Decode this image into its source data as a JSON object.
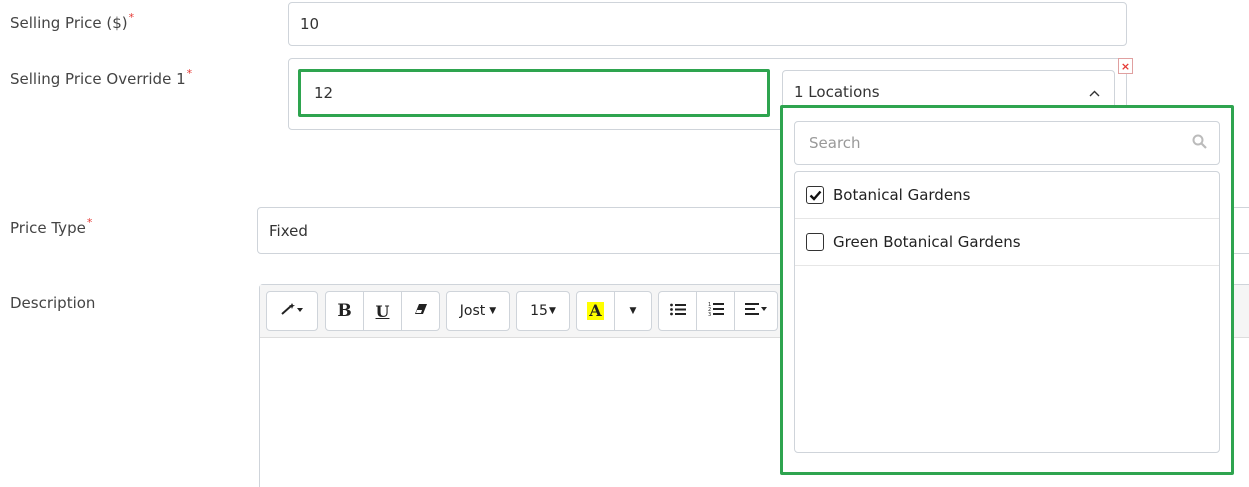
{
  "form": {
    "selling_price": {
      "label": "Selling Price ($)",
      "required": "*",
      "value": "10"
    },
    "override": {
      "label": "Selling Price Override 1",
      "required": "*",
      "value": "12",
      "locations_label": "1 Locations",
      "remove_symbol": "×"
    },
    "price_type": {
      "label": "Price Type",
      "required": "*",
      "value": "Fixed"
    },
    "description": {
      "label": "Description"
    }
  },
  "toolbar": {
    "font_name": "Jost",
    "font_size": "15",
    "icons": [
      "magic-wand-icon",
      "bold-icon",
      "underline-icon",
      "eraser-icon",
      "text-color-icon",
      "unordered-list-icon",
      "ordered-list-icon",
      "align-icon"
    ],
    "bold_glyph": "B",
    "underline_glyph": "U",
    "color_glyph": "A",
    "highlight_color": "#ffff00"
  },
  "dropdown": {
    "search_placeholder": "Search",
    "options": [
      {
        "label": "Botanical Gardens",
        "checked": true
      },
      {
        "label": "Green Botanical Gardens",
        "checked": false
      }
    ]
  },
  "colors": {
    "highlight_green": "#2ea44f",
    "required_red": "#e53935",
    "border": "#cfd4da"
  }
}
